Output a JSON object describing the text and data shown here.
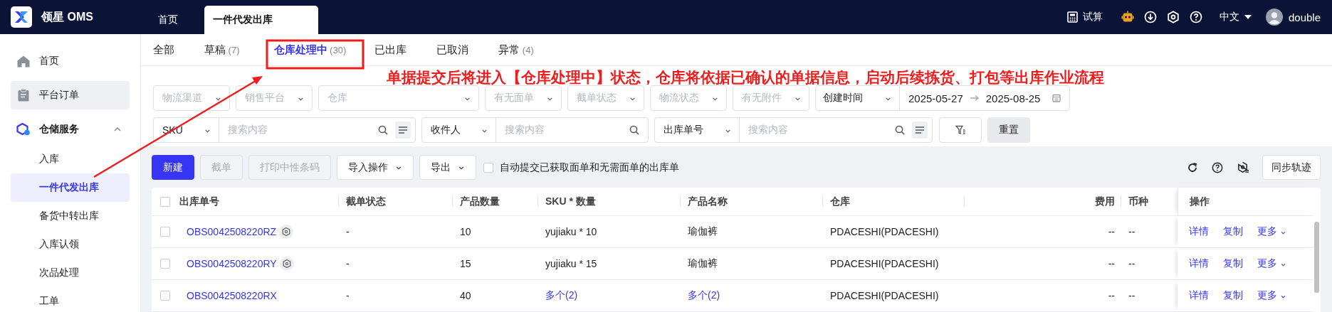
{
  "app": {
    "logo_text": "领星 OMS"
  },
  "page_tabs": [
    {
      "label": "首页",
      "selected": false
    },
    {
      "label": "一件代发出库",
      "selected": true
    }
  ],
  "header": {
    "calc_label": "试算",
    "language": "中文",
    "user": "double"
  },
  "sidebar": [
    {
      "label": "首页",
      "selected": false,
      "highlighted": false
    },
    {
      "label": "平台订单",
      "selected": false,
      "highlighted": true
    },
    {
      "label": "仓储服务",
      "selected": false,
      "highlighted": false,
      "expanded": true,
      "children": [
        {
          "label": "入库",
          "selected": false
        },
        {
          "label": "一件代发出库",
          "selected": true
        },
        {
          "label": "备货中转出库",
          "selected": false
        },
        {
          "label": "入库认领",
          "selected": false
        },
        {
          "label": "次品处理",
          "selected": false
        },
        {
          "label": "工单",
          "selected": false
        }
      ]
    }
  ],
  "status_tabs": [
    {
      "label": "全部",
      "selected": false
    },
    {
      "label": "草稿",
      "count": "(7)",
      "selected": false
    },
    {
      "label": "仓库处理中",
      "count": "(30)",
      "selected": true
    },
    {
      "label": "已出库",
      "selected": false
    },
    {
      "label": "已取消",
      "selected": false
    },
    {
      "label": "异常",
      "count": "(4)",
      "selected": false
    }
  ],
  "filters": [
    {
      "kind": "select",
      "placeholder": "物流渠道"
    },
    {
      "kind": "select",
      "placeholder": "销售平台"
    },
    {
      "kind": "select",
      "placeholder": "仓库"
    },
    {
      "kind": "select",
      "placeholder": "有无面单"
    },
    {
      "kind": "select",
      "placeholder": "截单状态"
    },
    {
      "kind": "select",
      "placeholder": "物流状态"
    },
    {
      "kind": "select",
      "placeholder": "有无附件"
    },
    {
      "kind": "date_range",
      "label": "创建时间",
      "start": "2025-05-27",
      "end": "2025-08-25"
    }
  ],
  "searches": [
    {
      "field": "SKU",
      "placeholder": "搜索内容",
      "multi": true
    },
    {
      "field": "收件人",
      "placeholder": "搜索内容",
      "multi": false
    },
    {
      "field": "出库单号",
      "placeholder": "搜索内容",
      "multi": true
    }
  ],
  "reset_label": "重置",
  "toolbar": {
    "buttons": [
      {
        "label": "新建",
        "kind": "primary",
        "disabled": false
      },
      {
        "label": "截单",
        "kind": "plain",
        "disabled": true
      },
      {
        "label": "打印中性条码",
        "kind": "plain",
        "disabled": true
      },
      {
        "label": "导入操作",
        "kind": "dropdown",
        "disabled": false
      },
      {
        "label": "导出",
        "kind": "dropdown",
        "disabled": false
      }
    ],
    "auto_submit": {
      "label": "自动提交已获取面单和无需面单的出库单",
      "checked": false
    },
    "sync_label": "同步轨迹"
  },
  "table": {
    "select_all_checked": false,
    "columns": [
      "出库单号",
      "截单状态",
      "产品数量",
      "SKU * 数量",
      "产品名称",
      "仓库",
      "费用",
      "币种",
      "操作"
    ],
    "rows": [
      {
        "checked": false,
        "order_no": "OBS0042508220RZ",
        "badge": true,
        "cutoff": "-",
        "qty": "10",
        "sku": "yujiaku * 10",
        "sku_link": false,
        "product": "瑜伽裤",
        "product_link": false,
        "warehouse": "PDACESHI(PDACESHI)",
        "fee": "--",
        "currency": "--",
        "actions": [
          "详情",
          "复制",
          "更多"
        ]
      },
      {
        "checked": false,
        "order_no": "OBS0042508220RY",
        "badge": true,
        "cutoff": "-",
        "qty": "15",
        "sku": "yujiaku * 15",
        "sku_link": false,
        "product": "瑜伽裤",
        "product_link": false,
        "warehouse": "PDACESHI(PDACESHI)",
        "fee": "--",
        "currency": "--",
        "actions": [
          "详情",
          "复制",
          "更多"
        ]
      },
      {
        "checked": false,
        "order_no": "OBS0042508220RX",
        "badge": false,
        "cutoff": "-",
        "qty": "40",
        "sku": "多个(2)",
        "sku_link": true,
        "product": "多个(2)",
        "product_link": true,
        "warehouse": "PDACESHI(PDACESHI)",
        "fee": "--",
        "currency": "--",
        "actions": [
          "详情",
          "复制",
          "更多"
        ]
      }
    ]
  },
  "annotation": {
    "text": "单据提交后将进入【仓库处理中】状态，仓库将依据已确认的单据信息，启动后续拣货、打包等出库作业流程"
  }
}
